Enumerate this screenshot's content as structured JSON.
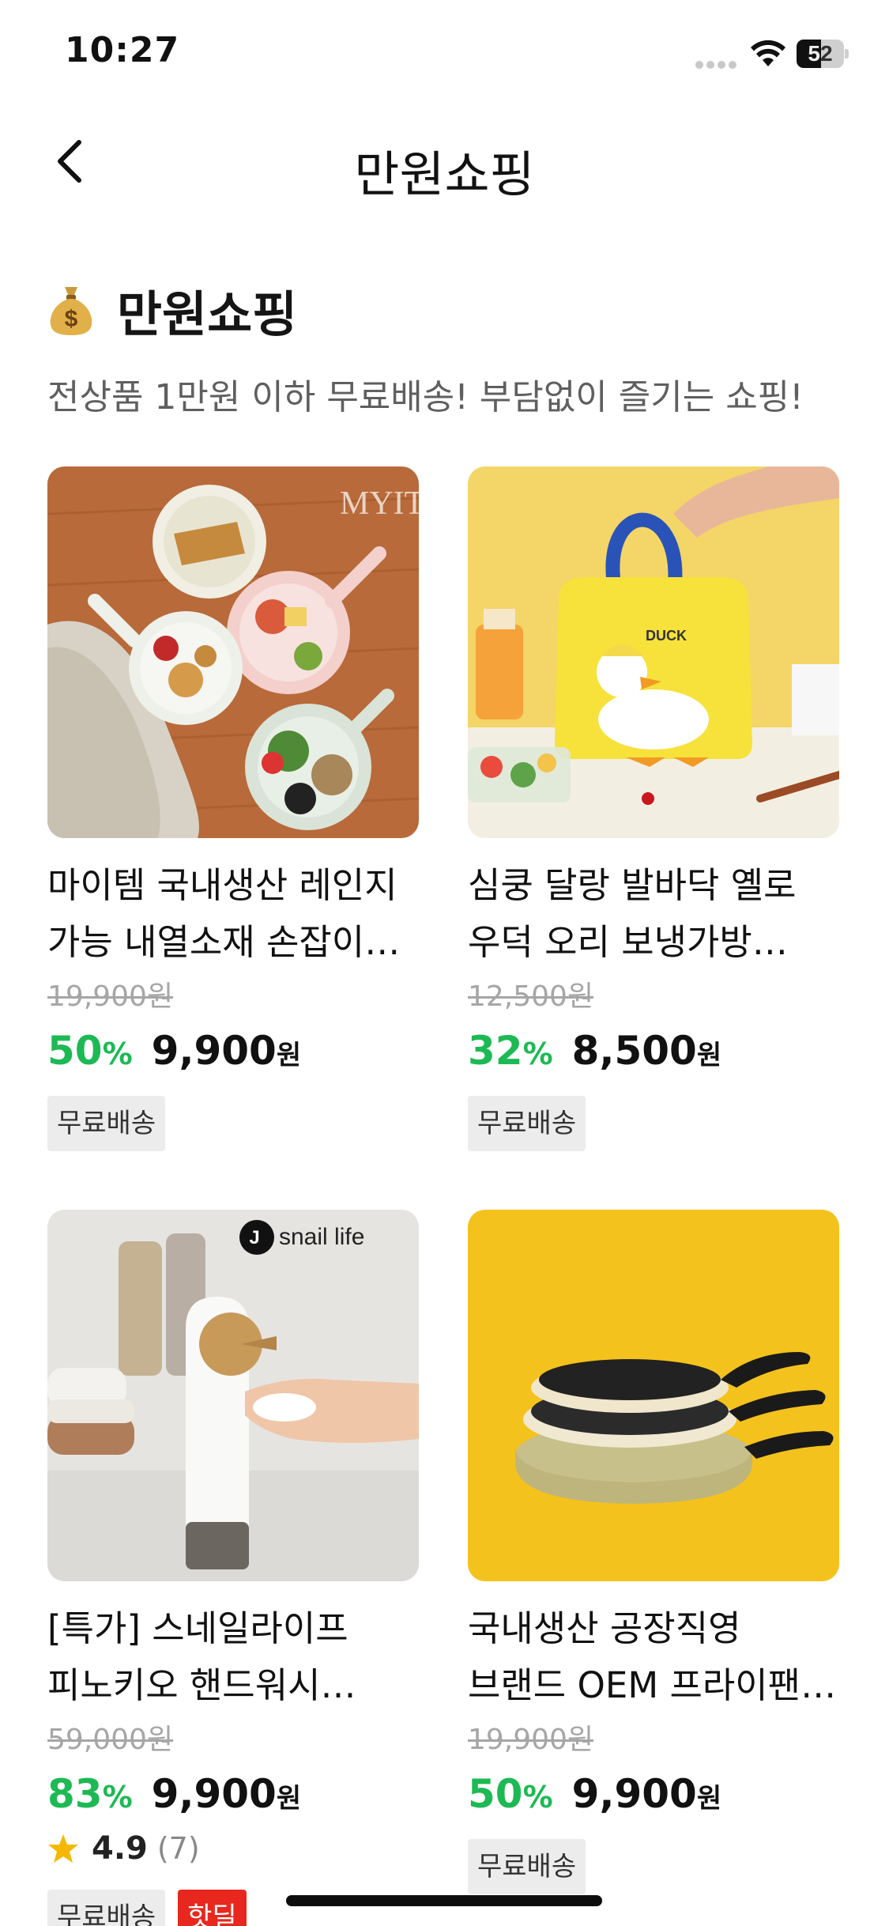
{
  "status": {
    "time": "10:27",
    "battery": "52",
    "battery_level": 0.52
  },
  "nav": {
    "title": "만원쇼핑",
    "back_icon": "chevron-left-icon"
  },
  "section": {
    "title": "만원쇼핑",
    "subtitle": "전상품 1만원 이하 무료배송! 부담없이 즐기는 쇼핑!",
    "icon": "money-bag-icon"
  },
  "products": [
    {
      "name": "마이템 국내생산 레인지 가능 내열소재 손잡이 구분 접시",
      "original_price": "19,900원",
      "discount": "50",
      "price": "9,900",
      "currency": "원",
      "tags": [
        "무료배송"
      ]
    },
    {
      "name": "심쿵 달랑 발바닥 옐로 우덕 오리 보냉가방 (보온보냉)",
      "original_price": "12,500원",
      "discount": "32",
      "price": "8,500",
      "currency": "원",
      "tags": [
        "무료배송"
      ]
    },
    {
      "name": "[특가] 스네일라이프 피노키오 핸드워시 디스펜서",
      "original_price": "59,000원",
      "discount": "83",
      "price": "9,900",
      "currency": "원",
      "rating": "4.9",
      "rating_count": "(7)",
      "tags": [
        "무료배송",
        "핫딜"
      ]
    },
    {
      "name": "국내생산 공장직영 브랜드 OEM 프라이팬/궁중팬",
      "original_price": "19,900원",
      "discount": "50",
      "price": "9,900",
      "currency": "원",
      "tags": [
        "무료배송"
      ]
    }
  ],
  "image_brands": {
    "p1": "MYITEM bono",
    "p2": "DUCK",
    "p3": "snail life"
  },
  "colors": {
    "accent_green": "#1db954",
    "hot_red": "#e8281e",
    "tag_bg": "#ececec"
  }
}
